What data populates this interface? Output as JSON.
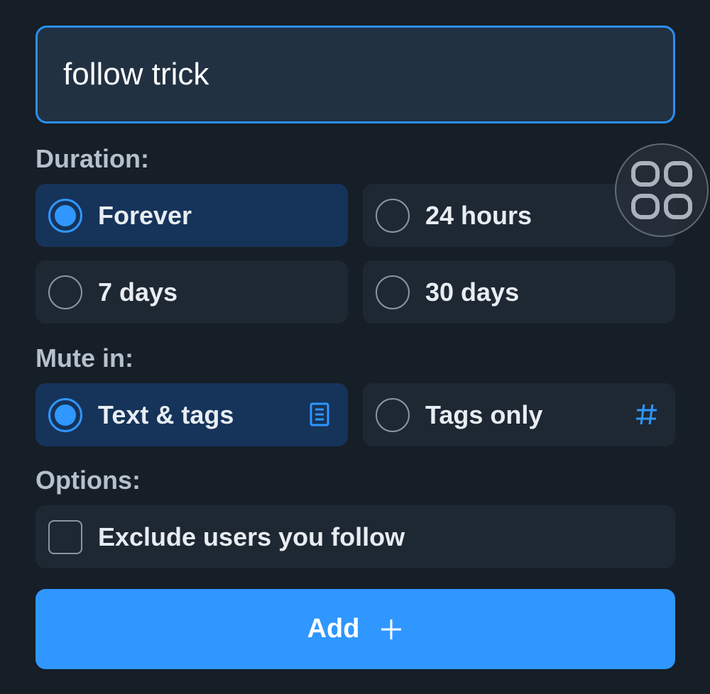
{
  "input": {
    "value": "follow trick"
  },
  "duration": {
    "label": "Duration:",
    "options": [
      {
        "label": "Forever",
        "selected": true
      },
      {
        "label": "24 hours",
        "selected": false
      },
      {
        "label": "7 days",
        "selected": false
      },
      {
        "label": "30 days",
        "selected": false
      }
    ]
  },
  "mute_in": {
    "label": "Mute in:",
    "options": [
      {
        "label": "Text & tags",
        "selected": true,
        "icon": "document-icon"
      },
      {
        "label": "Tags only",
        "selected": false,
        "icon": "hashtag-icon"
      }
    ]
  },
  "options_section": {
    "label": "Options:",
    "exclude_follow": {
      "label": "Exclude users you follow",
      "checked": false
    }
  },
  "add_button": {
    "label": "Add",
    "icon": "plus-icon"
  },
  "floating_button": {
    "icon": "app-grid-icon"
  },
  "colors": {
    "background": "#161e27",
    "accent": "#2f97ff",
    "selected_option": "#16335a",
    "option": "#1e2833"
  }
}
